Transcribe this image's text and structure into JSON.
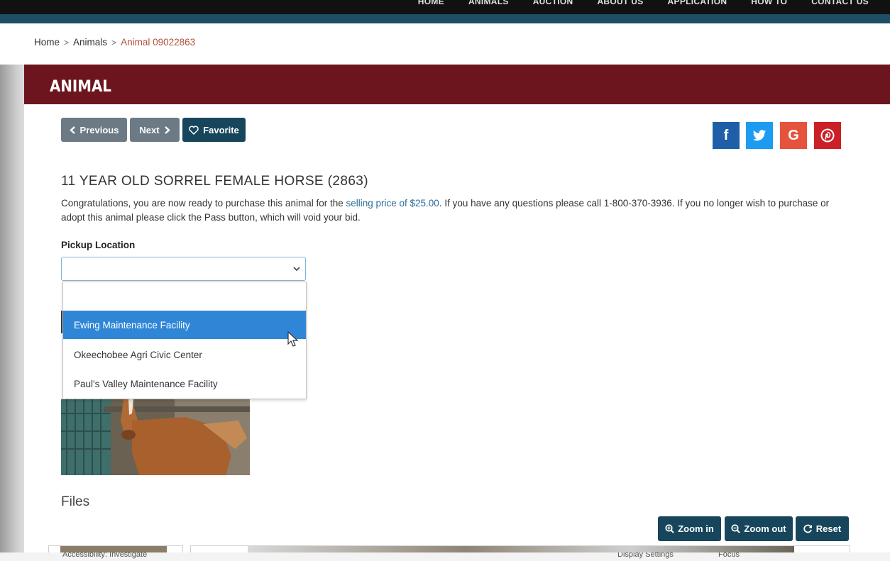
{
  "nav": {
    "links": [
      "HOME",
      "ANIMALS",
      "AUCTION",
      "ABOUT US",
      "APPLICATION",
      "HOW TO",
      "CONTACT US"
    ]
  },
  "breadcrumb": {
    "home": "Home",
    "animals": "Animals",
    "current": "Animal 09022863",
    "separator": ">"
  },
  "panel": {
    "title": "ANIMAL"
  },
  "buttons": {
    "previous": "Previous",
    "next": "Next",
    "favorite": "Favorite"
  },
  "social": {
    "facebook": "f",
    "google": "G",
    "colors": {
      "facebook": "#1f5fa8",
      "twitter": "#1d9bf0",
      "google": "#e5533d",
      "pinterest": "#cb2027"
    }
  },
  "animal": {
    "heading": "11 YEAR OLD SORREL FEMALE HORSE (2863)",
    "desc_pre": "Congratulations, you are now ready to purchase this animal for the ",
    "desc_link": "selling price of $25.00",
    "desc_post": ". If you have any questions please call 1-800-370-3936. If you no longer wish to purchase or adopt this animal please click the Pass button, which will void your bid."
  },
  "pickup": {
    "label": "Pickup Location",
    "selected": "",
    "options": [
      "Ewing Maintenance Facility",
      "Okeechobee Agri Civic Center",
      "Paul's Valley Maintenance Facility"
    ],
    "highlighted_index": 0
  },
  "files": {
    "heading": "Files"
  },
  "zoom": {
    "zoom_in": "Zoom in",
    "zoom_out": "Zoom out",
    "reset": "Reset"
  },
  "taskbar": {
    "left": "Accessibility: Investigate",
    "display": "Display Settings",
    "focus": "Focus"
  },
  "colors": {
    "header_bg": "#6d151e",
    "dark_button": "#17465c",
    "grey_button": "#6c7a85",
    "link": "#2d6f9a",
    "highlight": "#2f86d6"
  }
}
